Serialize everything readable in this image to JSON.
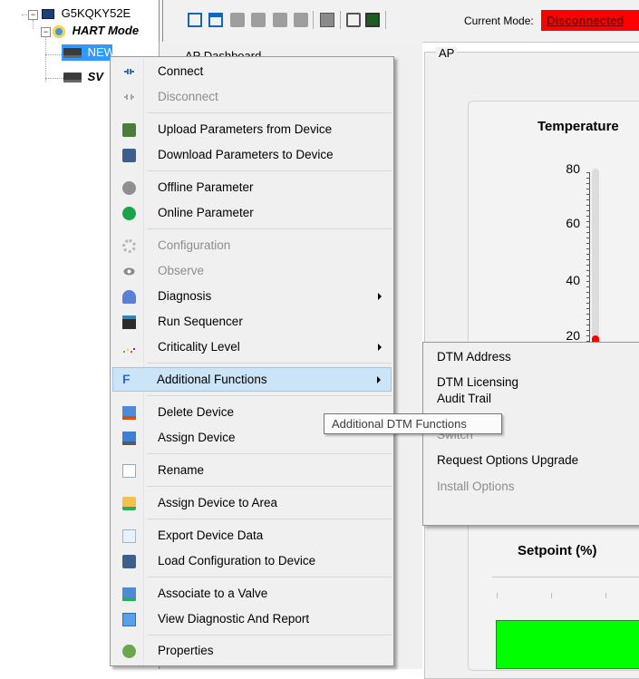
{
  "tree": {
    "root": "G5KQKY52E",
    "hart_modem": "HART Mode",
    "selected": "NEW",
    "sibling": "SV"
  },
  "toolbar": {
    "mode_label": "Current Mode:",
    "mode_status": "Disconnected",
    "mode_status_color": "#ff0000"
  },
  "panel": {
    "tab_partial": "AP Dashboard",
    "group_label": "AP",
    "temperature": {
      "title": "Temperature",
      "ticks": [
        "80",
        "60",
        "40",
        "20"
      ],
      "value_fraction": 0.2
    },
    "setpoint_title": "Setpoint (%)"
  },
  "context_menu": {
    "items": [
      {
        "label": "Connect",
        "icon": "connect-icon",
        "enabled": true
      },
      {
        "label": "Disconnect",
        "icon": "disconnect-icon",
        "enabled": false
      },
      {
        "label": "Upload Parameters from Device",
        "icon": "upload-icon",
        "enabled": true
      },
      {
        "label": "Download Parameters to Device",
        "icon": "download-icon",
        "enabled": true
      },
      {
        "label": "Offline Parameter",
        "icon": "offline-parameter-icon",
        "enabled": true
      },
      {
        "label": "Online Parameter",
        "icon": "online-parameter-icon",
        "enabled": true
      },
      {
        "label": "Configuration",
        "icon": "gear-icon",
        "enabled": false
      },
      {
        "label": "Observe",
        "icon": "eye-icon",
        "enabled": false
      },
      {
        "label": "Diagnosis",
        "icon": "diagnosis-icon",
        "enabled": true,
        "submenu": true
      },
      {
        "label": "Run Sequencer",
        "icon": "sequencer-icon",
        "enabled": true
      },
      {
        "label": "Criticality Level",
        "icon": "criticality-icon",
        "enabled": true,
        "submenu": true
      },
      {
        "label": "Additional Functions",
        "icon": "function-icon",
        "enabled": true,
        "submenu": true,
        "highlighted": true
      },
      {
        "label": "Delete Device",
        "icon": "delete-device-icon",
        "enabled": true
      },
      {
        "label": "Assign Device",
        "icon": "assign-device-icon",
        "enabled": true
      },
      {
        "label": "Rename",
        "icon": "rename-icon",
        "enabled": true
      },
      {
        "label": "Assign Device to Area",
        "icon": "folder-icon",
        "enabled": true
      },
      {
        "label": "Export Device Data",
        "icon": "export-icon",
        "enabled": true
      },
      {
        "label": "Load Configuration to Device",
        "icon": "load-config-icon",
        "enabled": true
      },
      {
        "label": "Associate to a Valve",
        "icon": "valve-icon",
        "enabled": true
      },
      {
        "label": "View Diagnostic And Report",
        "icon": "report-icon",
        "enabled": true
      },
      {
        "label": "Properties",
        "icon": "properties-icon",
        "enabled": true
      }
    ]
  },
  "submenu": {
    "items": [
      {
        "label": "DTM Address",
        "enabled": true
      },
      {
        "label": "DTM Licensing",
        "enabled": true
      },
      {
        "label": "Audit Trail",
        "enabled": true
      },
      {
        "label": "Switch",
        "enabled": false
      },
      {
        "label": "Request Options Upgrade",
        "enabled": true
      },
      {
        "label": "Install Options",
        "enabled": false
      }
    ]
  },
  "tooltip": "Additional DTM Functions"
}
